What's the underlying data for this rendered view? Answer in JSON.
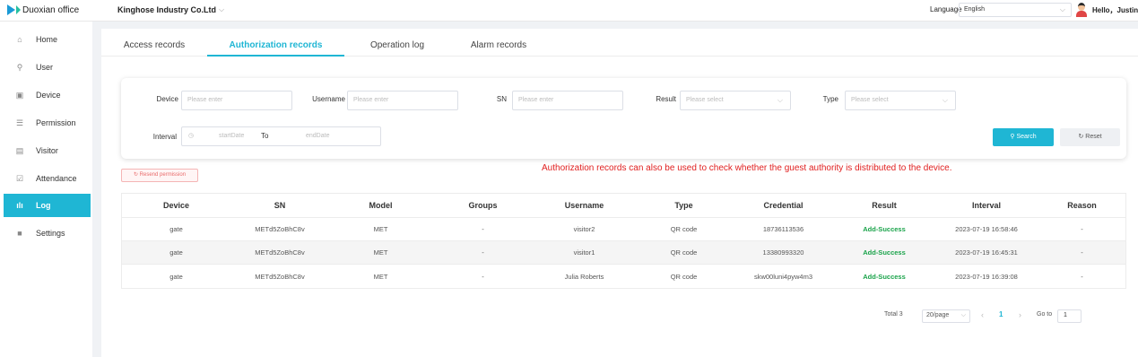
{
  "app": {
    "logo_text": "Duoxian office"
  },
  "header": {
    "company": "Kinghose Industry Co.Ltd",
    "language_label": "Language",
    "language_value": "English",
    "greeting": "Hello，Justin"
  },
  "sidebar": {
    "items": [
      {
        "label": "Home",
        "icon": "home-icon"
      },
      {
        "label": "User",
        "icon": "user-icon"
      },
      {
        "label": "Device",
        "icon": "device-icon"
      },
      {
        "label": "Permission",
        "icon": "permission-icon"
      },
      {
        "label": "Visitor",
        "icon": "visitor-icon"
      },
      {
        "label": "Attendance",
        "icon": "attendance-icon"
      },
      {
        "label": "Log",
        "icon": "log-icon",
        "active": true
      },
      {
        "label": "Settings",
        "icon": "settings-icon"
      }
    ]
  },
  "tabs": [
    "Access records",
    "Authorization records",
    "Operation log",
    "Alarm records"
  ],
  "active_tab": "Authorization records",
  "filters": {
    "device_label": "Device",
    "device_placeholder": "Please enter",
    "username_label": "Username",
    "username_placeholder": "Please enter",
    "sn_label": "SN",
    "sn_placeholder": "Please enter",
    "result_label": "Result",
    "result_placeholder": "Please select",
    "type_label": "Type",
    "type_placeholder": "Please select",
    "interval_label": "Interval",
    "start_placeholder": "startDate",
    "to_label": "To",
    "end_placeholder": "endDate",
    "search_button": "Search",
    "reset_button": "Reset"
  },
  "resend_button": "Resend permission",
  "annotation": "Authorization records can also be used to check whether the guest authority is distributed to the device.",
  "table": {
    "columns": [
      "Device",
      "SN",
      "Model",
      "Groups",
      "Username",
      "Type",
      "Credential",
      "Result",
      "Interval",
      "Reason"
    ],
    "rows": [
      [
        "gate",
        "METd5ZoBhC8v",
        "MET",
        "-",
        "visitor2",
        "QR code",
        "18736113536",
        "Add-Success",
        "2023-07-19 16:58:46",
        "-"
      ],
      [
        "gate",
        "METd5ZoBhC8v",
        "MET",
        "-",
        "visitor1",
        "QR code",
        "13380993320",
        "Add-Success",
        "2023-07-19 16:45:31",
        "-"
      ],
      [
        "gate",
        "METd5ZoBhC8v",
        "MET",
        "-",
        "Julia Roberts",
        "QR code",
        "skw00luni4pyw4m3",
        "Add-Success",
        "2023-07-19 16:39:08",
        "-"
      ]
    ]
  },
  "pagination": {
    "total": "Total 3",
    "page_size": "20/page",
    "current_page": "1",
    "goto_label": "Go to",
    "goto_value": "1"
  },
  "colors": {
    "accent": "#1fb6d4",
    "success": "#1aa34a",
    "annotation": "#e02020"
  }
}
